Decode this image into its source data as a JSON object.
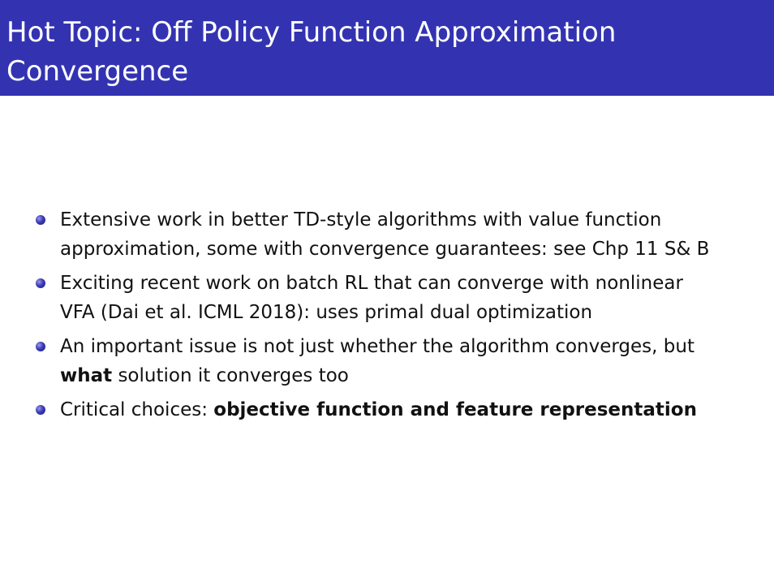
{
  "title": {
    "line1": "Hot Topic: Off Policy Function Approximation",
    "line2": "Convergence"
  },
  "bullets": [
    {
      "line1": "Extensive work in better TD-style algorithms with value function",
      "line2": "approximation, some with convergence guarantees: see Chp 11 S& B"
    },
    {
      "line1": "Exciting recent work on batch RL that can converge with nonlinear",
      "line2": "VFA (Dai et al. ICML 2018): uses primal dual optimization"
    },
    {
      "line1": "An important issue is not just whether the algorithm converges, but",
      "line2_bold": "what",
      "line2_rest": " solution it converges too"
    },
    {
      "line1_plain": "Critical choices: ",
      "line1_bold": "objective function and feature representation"
    }
  ],
  "colors": {
    "title_bar": "#3333b2",
    "title_text": "#ffffff",
    "bullet_ball": "#3b3bb8",
    "body_text": "#111111"
  }
}
